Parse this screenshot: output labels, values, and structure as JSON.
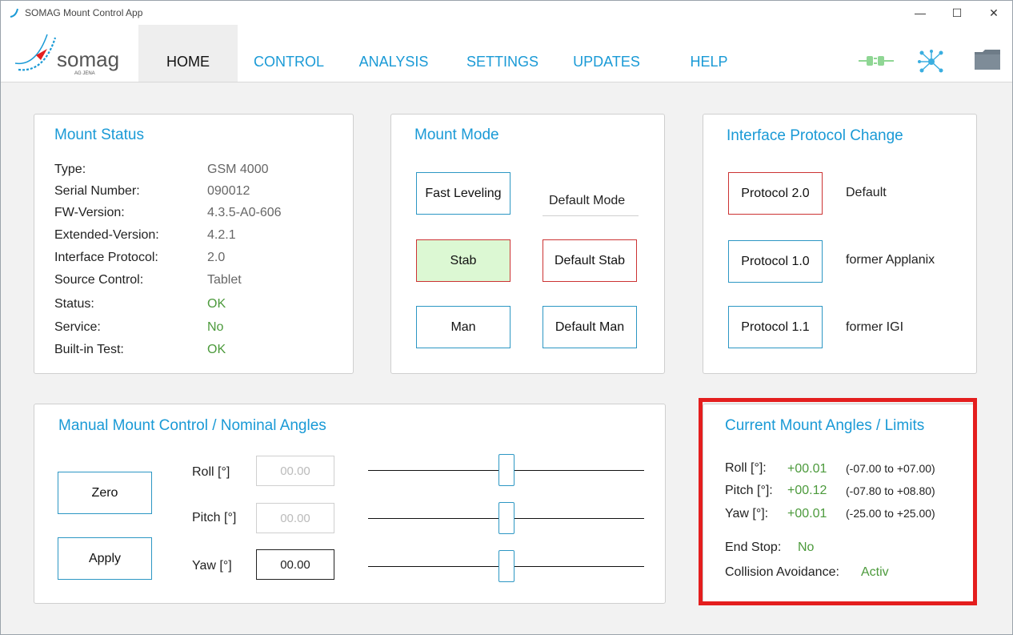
{
  "window": {
    "title": "SOMAG Mount Control App"
  },
  "logo": {
    "text": "somag",
    "subtext": "AG JENA"
  },
  "tabs": [
    "HOME",
    "CONTROL",
    "ANALYSIS",
    "SETTINGS",
    "UPDATES",
    "HELP"
  ],
  "mount_status": {
    "title": "Mount Status",
    "rows": [
      {
        "label": "Type:",
        "value": "GSM 4000"
      },
      {
        "label": "Serial Number:",
        "value": "090012"
      },
      {
        "label": "FW-Version:",
        "value": "4.3.5-A0-606"
      },
      {
        "label": "Extended-Version:",
        "value": "4.2.1"
      },
      {
        "label": "Interface Protocol:",
        "value": "2.0"
      },
      {
        "label": "Source Control:",
        "value": "Tablet"
      },
      {
        "label": "Status:",
        "value": "OK"
      },
      {
        "label": "Service:",
        "value": "No"
      },
      {
        "label": "Built-in Test:",
        "value": "OK"
      }
    ]
  },
  "mount_mode": {
    "title": "Mount Mode",
    "fast_leveling": "Fast Leveling",
    "default_mode": "Default Mode",
    "stab": "Stab",
    "default_stab": "Default Stab",
    "man": "Man",
    "default_man": "Default Man"
  },
  "protocol": {
    "title": "Interface Protocol Change",
    "items": [
      {
        "button": "Protocol 2.0",
        "desc": "Default"
      },
      {
        "button": "Protocol 1.0",
        "desc": "former Applanix"
      },
      {
        "button": "Protocol 1.1",
        "desc": "former IGI"
      }
    ]
  },
  "manual": {
    "title": "Manual Mount Control / Nominal Angles",
    "zero": "Zero",
    "apply": "Apply",
    "roll_label": "Roll [°]",
    "pitch_label": "Pitch [°]",
    "yaw_label": "Yaw [°]",
    "roll_value": "00.00",
    "pitch_value": "00.00",
    "yaw_value": "00.00",
    "slider_position": 0.5
  },
  "current": {
    "title": "Current Mount Angles / Limits",
    "roll_label": "Roll [°]:",
    "roll_value": "+00.01",
    "roll_limits": "(-07.00 to +07.00)",
    "pitch_label": "Pitch [°]:",
    "pitch_value": "+00.12",
    "pitch_limits": "(-07.80 to +08.80)",
    "yaw_label": "Yaw [°]:",
    "yaw_value": "+00.01",
    "yaw_limits": "(-25.00 to +25.00)",
    "end_stop_label": "End Stop:",
    "end_stop_value": "No",
    "collision_label": "Collision Avoidance:",
    "collision_value": "Activ"
  },
  "colors": {
    "accent": "#1a9ad6",
    "green": "#4c9a3c",
    "highlight": "#e41e1e"
  }
}
